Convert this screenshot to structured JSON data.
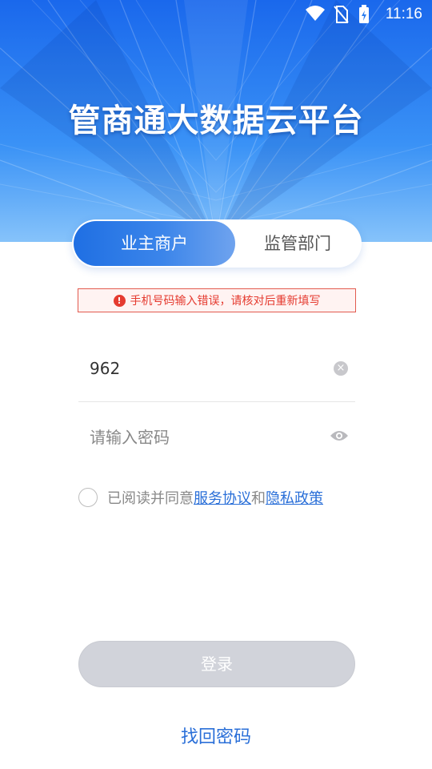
{
  "status_bar": {
    "time": "11:16",
    "icons": [
      "wifi-icon",
      "no-sim-icon",
      "battery-charging-icon"
    ]
  },
  "header": {
    "title": "管商通大数据云平台"
  },
  "tabs": [
    {
      "label": "业主商户",
      "active": true
    },
    {
      "label": "监管部门",
      "active": false
    }
  ],
  "error": {
    "icon": "error-icon",
    "message": "手机号码输入错误，请核对后重新填写"
  },
  "form": {
    "phone_value": "962",
    "password_placeholder": "请输入密码",
    "clear_icon": "clear-icon",
    "visibility_icon": "eye-icon"
  },
  "agreement": {
    "prefix": "已阅读并同意",
    "terms_link": "服务协议",
    "conjunction": "和",
    "privacy_link": "隐私政策"
  },
  "actions": {
    "login_label": "登录",
    "forgot_label": "找回密码"
  },
  "colors": {
    "brand_blue": "#1f6fe3",
    "link_blue": "#2a6fd8",
    "error_red": "#e53b30",
    "disabled_button": "#d1d3da"
  }
}
